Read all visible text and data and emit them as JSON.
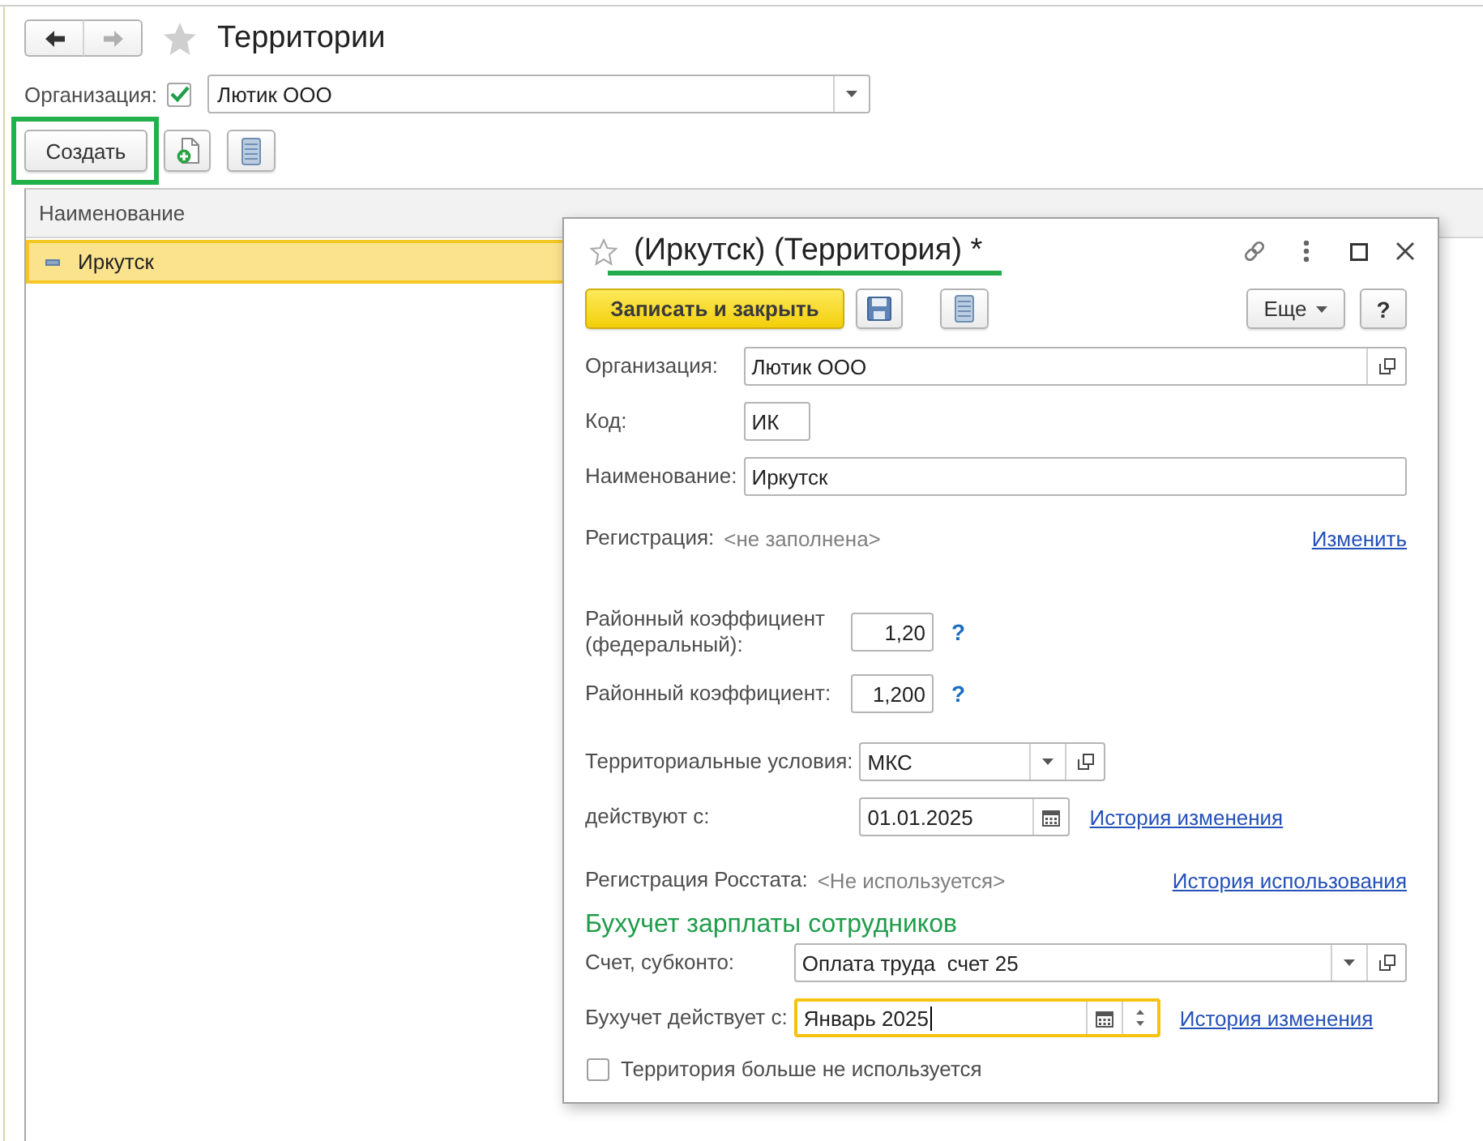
{
  "nav": [
    {
      "kind": "back",
      "disabled": false
    },
    {
      "kind": "forward",
      "disabled": true
    }
  ],
  "page": {
    "title": "Территории",
    "favorite": false
  },
  "filter": {
    "label": "Организация:",
    "checked": true,
    "value": "Лютик ООО"
  },
  "toolbar": [
    {
      "kind": "create",
      "label": "Создать",
      "annotated": true
    },
    {
      "kind": "add",
      "annotated": false
    },
    {
      "kind": "list",
      "annotated": false
    }
  ],
  "table": {
    "columns": [
      "Наименование"
    ],
    "rows": [
      {
        "cells": [
          "Иркутск"
        ],
        "selected": true
      }
    ]
  },
  "dialog": {
    "title": "(Иркутск) (Территория) *",
    "favorite": false,
    "title_annotated": true,
    "toolbar": [
      {
        "kind": "primary",
        "label": "Записать и закрыть"
      },
      {
        "kind": "save"
      },
      {
        "kind": "list"
      },
      {
        "kind": "menu",
        "label": "Еще"
      },
      {
        "kind": "help",
        "label": "?"
      }
    ],
    "groups": [
      {
        "kind": "fields",
        "rows": [
          {
            "kind": "ref",
            "label": "Организация:",
            "value": "Лютик ООО",
            "focused": false
          },
          {
            "kind": "code",
            "label": "Код:",
            "value": "ИК",
            "focused": false
          },
          {
            "kind": "text",
            "label": "Наименование:",
            "value": "Иркутск",
            "focused": false
          }
        ]
      },
      {
        "kind": "info",
        "label": "Регистрация:",
        "value": "<не заполнена>",
        "link": "Изменить"
      },
      {
        "kind": "fields",
        "rows": [
          {
            "kind": "number",
            "label": "Районный коэффициент (федеральный):",
            "value": "1,20",
            "help": "?",
            "focused": false
          },
          {
            "kind": "number",
            "label": "Районный коэффициент:",
            "value": "1,200",
            "help": "?",
            "focused": false
          }
        ]
      },
      {
        "kind": "fields",
        "rows": [
          {
            "kind": "short-select",
            "label": "Территориальные условия:",
            "value": "МКС",
            "focused": false
          },
          {
            "kind": "date",
            "label": "действуют с:",
            "value": "01.01.2025",
            "link": "История изменения",
            "focused": false
          }
        ]
      },
      {
        "kind": "info",
        "label": "Регистрация Росстата:",
        "value": "<Не используется>",
        "link": "История использования"
      },
      {
        "kind": "heading",
        "text": "Бухучет зарплаты сотрудников"
      },
      {
        "kind": "fields",
        "rows": [
          {
            "kind": "select",
            "label": "Счет, субконто:",
            "value": "Оплата труда  счет 25",
            "focused": false
          },
          {
            "kind": "month",
            "label": "Бухучет действует с:",
            "value": "Январь 2025",
            "link": "История изменения",
            "focused": true
          }
        ]
      },
      {
        "kind": "checkbox",
        "label": "Территория больше не используется",
        "checked": false
      }
    ]
  }
}
